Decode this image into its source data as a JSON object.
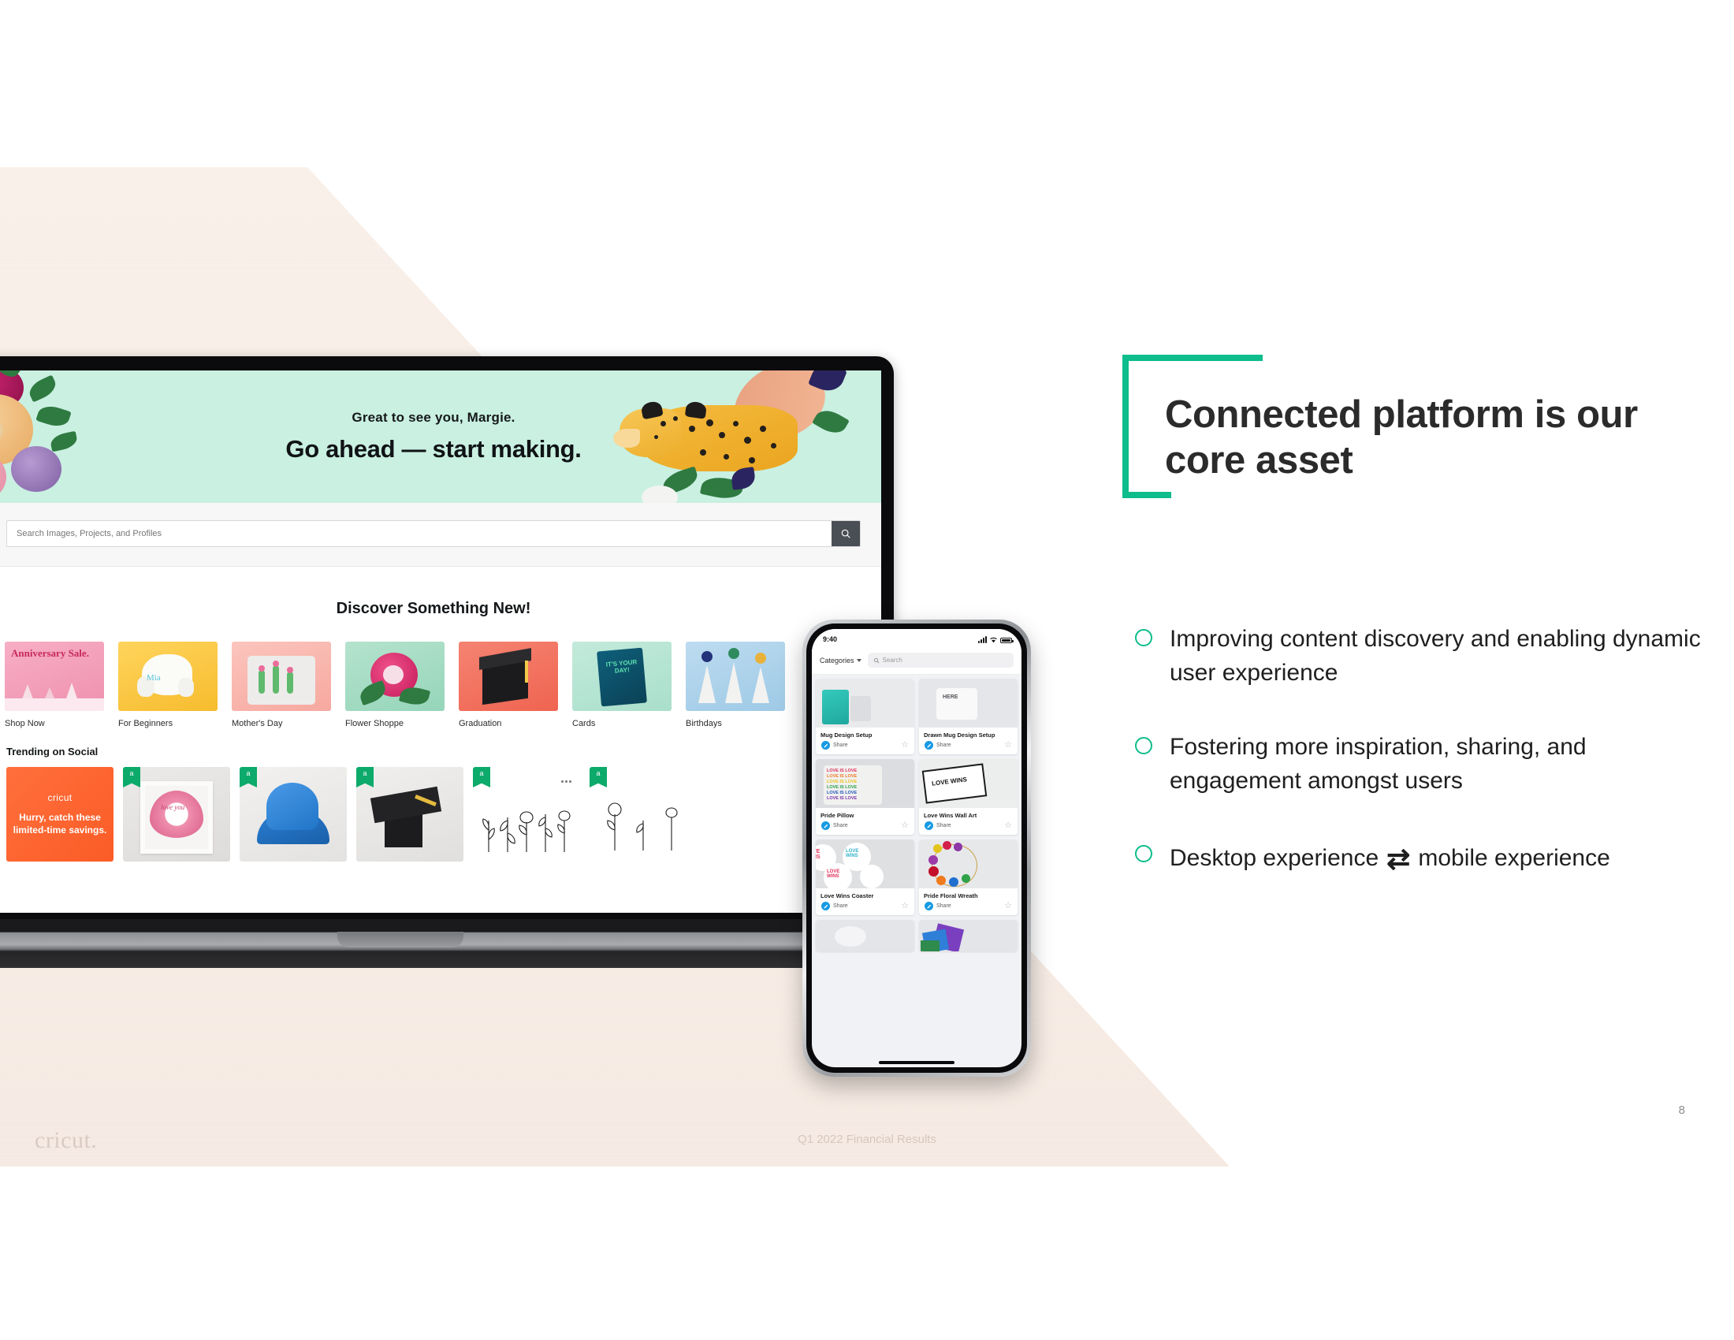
{
  "slide": {
    "page_number": "8",
    "footer_note": "Q1 2022 Financial Results",
    "brand_logo": "cricut.",
    "accent_green": "#0dbd8b",
    "background_beige": "#f7ece4"
  },
  "headline": {
    "line1": "Connected platform is our",
    "line2": "core asset"
  },
  "bullets": [
    {
      "text": "Improving content discovery and enabling dynamic user experience"
    },
    {
      "text": "Fostering more inspiration, sharing, and engagement amongst users"
    },
    {
      "text_before": "Desktop experience",
      "symbol": "⇄",
      "text_after": "mobile experience"
    }
  ],
  "laptop": {
    "hero": {
      "greeting": "Great to see you, Margie.",
      "title": "Go ahead — start making.",
      "banner_color": "#c9f0e1"
    },
    "search": {
      "placeholder": "Search Images, Projects, and Profiles",
      "value": "",
      "icon": "search-icon"
    },
    "discover": {
      "title": "Discover Something New!",
      "categories": [
        {
          "label": "Shop Now",
          "thumb_color": "#f2a0b8",
          "badge": "Anniversary Sale."
        },
        {
          "label": "For Beginners",
          "thumb_color": "#fdd04e",
          "badge": ""
        },
        {
          "label": "Mother's Day",
          "thumb_color": "#f9bcb5",
          "badge": ""
        },
        {
          "label": "Flower Shoppe",
          "thumb_color": "#a9ddc6",
          "badge": ""
        },
        {
          "label": "Graduation",
          "thumb_color": "#f2715e",
          "badge": ""
        },
        {
          "label": "Cards",
          "thumb_color": "#b9e6d3",
          "badge": "IT'S YOUR DAY!"
        },
        {
          "label": "Birthdays",
          "thumb_color": "#aacfe9",
          "badge": ""
        }
      ]
    },
    "trending": {
      "title": "Trending on Social",
      "promo": {
        "brand": "cricut",
        "message": "Hurry, catch these limited-time savings."
      },
      "cards": [
        {
          "flag": "a"
        },
        {
          "flag": "a"
        },
        {
          "flag": "a"
        },
        {
          "flag": "a"
        },
        {
          "flag": "a"
        }
      ]
    }
  },
  "phone": {
    "status": {
      "time": "9:40",
      "signal": "signal-icon",
      "wifi": "wifi-icon",
      "battery": "battery-icon"
    },
    "topbar": {
      "categories_label": "Categories",
      "search_placeholder": "Search"
    },
    "cards": [
      {
        "title": "Mug Design Setup",
        "share_label": "Share"
      },
      {
        "title": "Drawn Mug Design Setup",
        "share_label": "Share"
      },
      {
        "title": "Pride Pillow",
        "share_label": "Share"
      },
      {
        "title": "Love Wins Wall Art",
        "share_label": "Share"
      },
      {
        "title": "Love Wins Coaster",
        "share_label": "Share"
      },
      {
        "title": "Pride Floral Wreath",
        "share_label": "Share"
      }
    ]
  }
}
